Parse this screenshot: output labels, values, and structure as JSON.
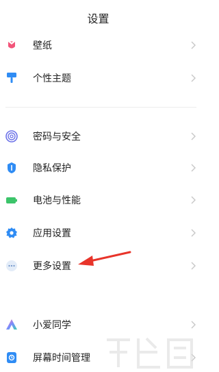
{
  "header": {
    "title": "设置"
  },
  "items": [
    {
      "label": "壁纸",
      "icon": "wallpaper-icon"
    },
    {
      "label": "个性主题",
      "icon": "theme-brush-icon"
    },
    {
      "label": "密码与安全",
      "icon": "fingerprint-icon"
    },
    {
      "label": "隐私保护",
      "icon": "privacy-shield-icon"
    },
    {
      "label": "电池与性能",
      "icon": "battery-icon"
    },
    {
      "label": "应用设置",
      "icon": "app-settings-gear-icon"
    },
    {
      "label": "更多设置",
      "icon": "more-dots-icon"
    },
    {
      "label": "小爱同学",
      "icon": "xiaoai-assistant-icon"
    },
    {
      "label": "屏幕时间管理",
      "icon": "screen-time-icon"
    }
  ],
  "colors": {
    "wallpaper": "#f2557a",
    "theme": "#2f8cf4",
    "security": "#6c72e8",
    "privacy": "#2f8cf4",
    "battery": "#3cc46a",
    "app_settings": "#2f8cf4",
    "more": "#9ab3d6",
    "arrow": "#e8342a"
  }
}
